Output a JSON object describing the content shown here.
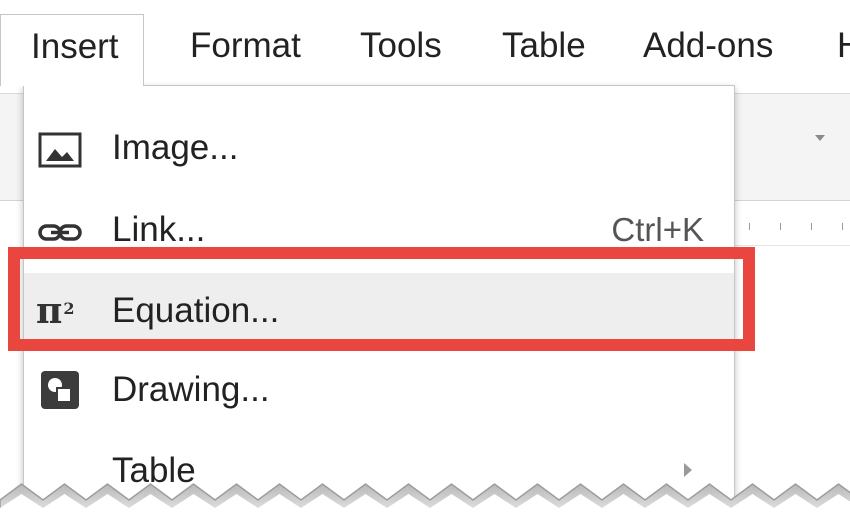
{
  "menubar": {
    "items": [
      {
        "label": "Insert",
        "state": "open"
      },
      {
        "label": "Format"
      },
      {
        "label": "Tools"
      },
      {
        "label": "Table"
      },
      {
        "label": "Add-ons"
      },
      {
        "label": "H"
      }
    ]
  },
  "insert_menu": {
    "items": [
      {
        "label": "Image...",
        "icon": "image-icon"
      },
      {
        "label": "Link...",
        "icon": "link-icon",
        "shortcut": "Ctrl+K"
      },
      {
        "label": "Equation...",
        "icon": "equation-icon",
        "state": "highlighted"
      },
      {
        "label": "Drawing...",
        "icon": "drawing-icon"
      },
      {
        "label": "Table",
        "submenu": true
      }
    ]
  },
  "annotation": {
    "highlight_color": "#e8463f",
    "target": "Equation..."
  },
  "colors": {
    "menu_text": "#222222",
    "hover_bg": "#eeeeee",
    "toolbar_bg": "#f4f4f4"
  }
}
